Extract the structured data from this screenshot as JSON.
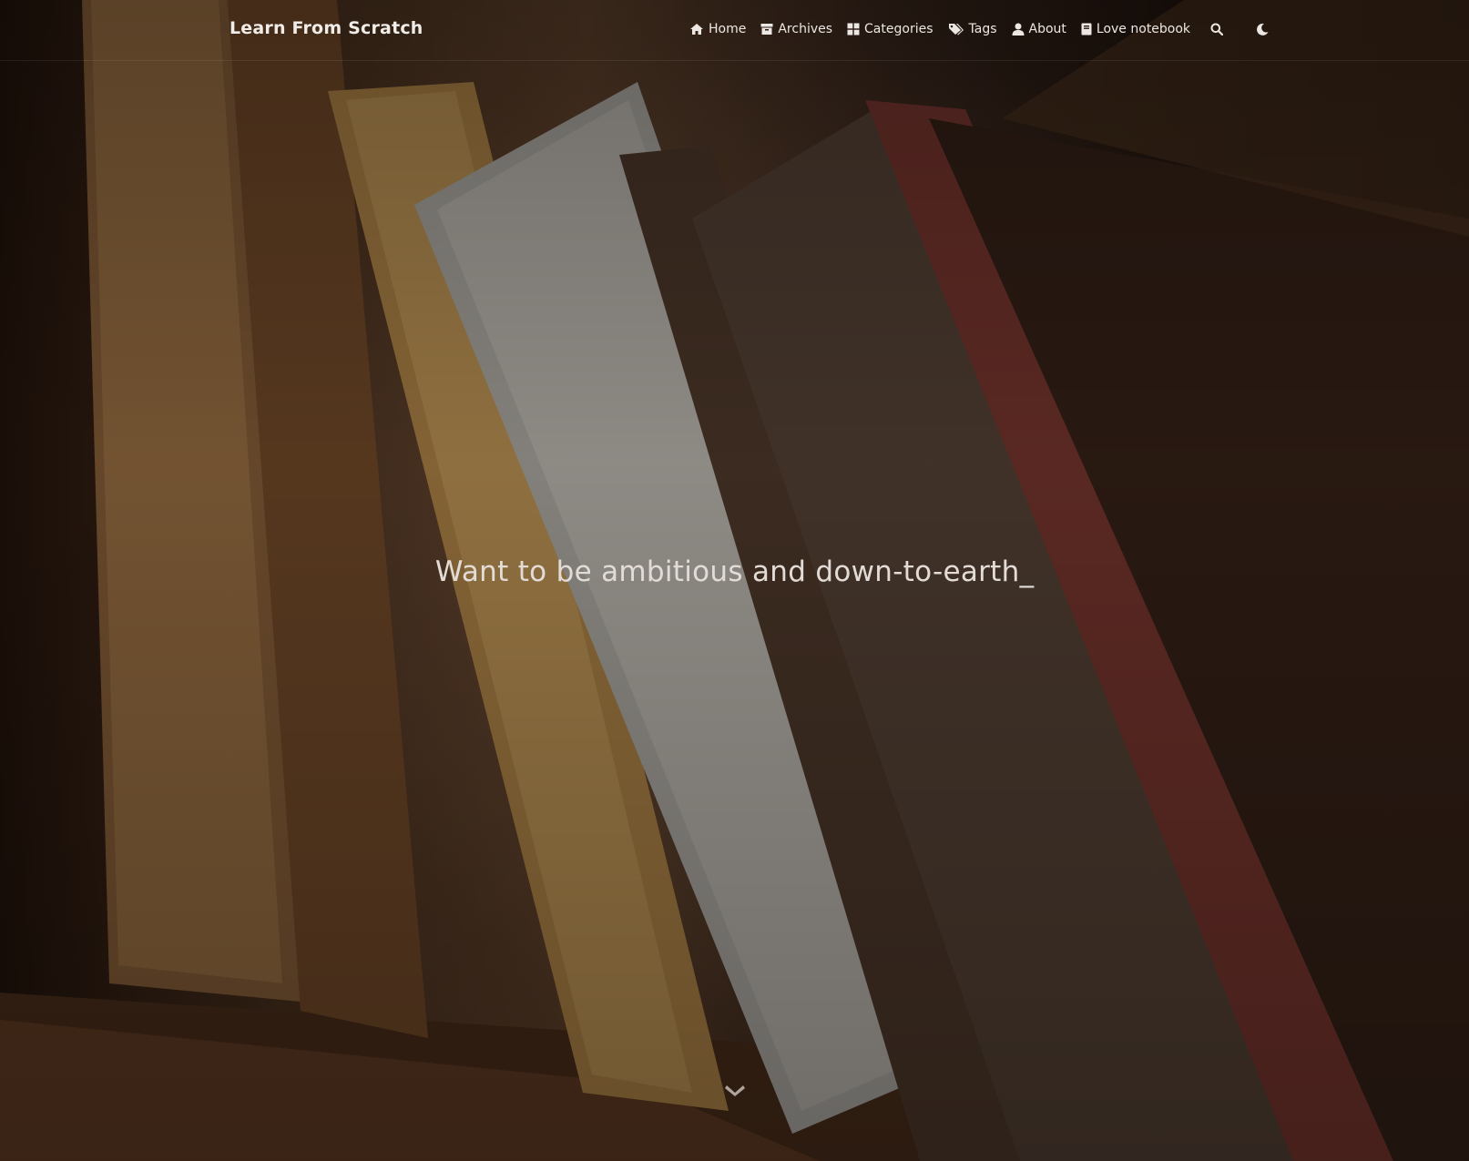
{
  "site": {
    "brand": "Learn From Scratch"
  },
  "nav": {
    "items": [
      {
        "label": "Home",
        "icon": "home-icon"
      },
      {
        "label": "Archives",
        "icon": "archive-icon"
      },
      {
        "label": "Categories",
        "icon": "categories-icon"
      },
      {
        "label": "Tags",
        "icon": "tags-icon"
      },
      {
        "label": "About",
        "icon": "user-icon"
      },
      {
        "label": "Love notebook",
        "icon": "book-icon"
      }
    ],
    "search_icon": "search-icon",
    "theme_icon": "moon-icon"
  },
  "hero": {
    "subtitle": "Want to be ambitious and down-to-earth",
    "cursor": "_",
    "scroll_icon": "chevron-down-icon"
  },
  "colors": {
    "text": "#ece7e2",
    "background": "#2a1a10"
  }
}
